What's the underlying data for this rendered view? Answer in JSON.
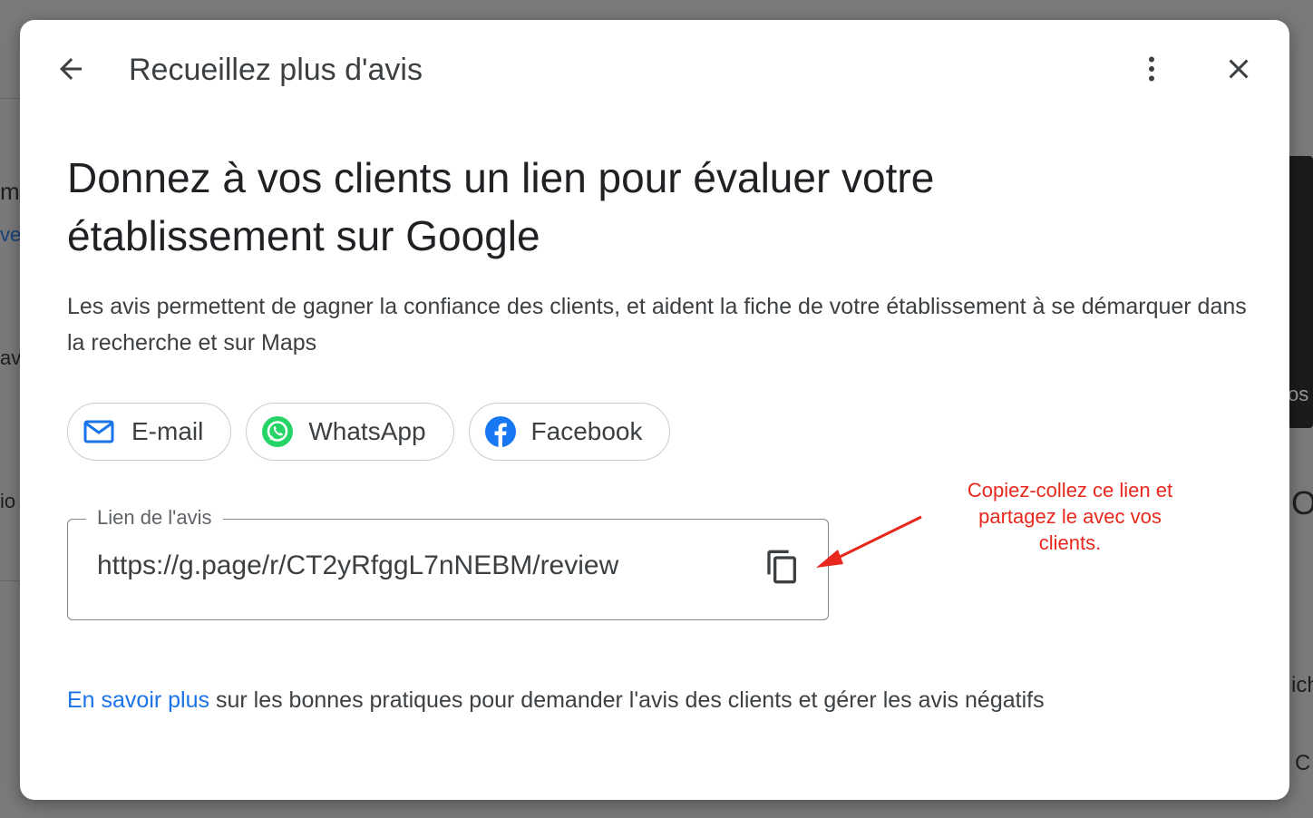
{
  "dialog": {
    "title": "Recueillez plus d'avis",
    "headline": "Donnez à vos clients un lien pour évaluer votre établissement sur Google",
    "description": "Les avis permettent de gagner la confiance des clients, et aident la fiche de votre établissement à se démarquer dans la recherche et sur Maps",
    "share_buttons": [
      {
        "label": "E-mail",
        "icon": "mail-icon"
      },
      {
        "label": "WhatsApp",
        "icon": "whatsapp-icon"
      },
      {
        "label": "Facebook",
        "icon": "facebook-icon"
      }
    ],
    "link_field": {
      "label": "Lien de l'avis",
      "value": "https://g.page/r/CT2yRfggL7nNEBM/review",
      "copy_icon": "copy-icon"
    },
    "annotation": "Copiez-collez ce lien et partagez le avec vos clients.",
    "footer": {
      "link_text": "En savoir plus",
      "text": " sur les bonnes pratiques pour demander l'avis des clients et gérer les avis négatifs"
    }
  },
  "colors": {
    "accent_blue": "#1a73e8",
    "annotation_red": "#e8281c",
    "whatsapp_green": "#25d366",
    "facebook_blue": "#1877f2"
  }
}
